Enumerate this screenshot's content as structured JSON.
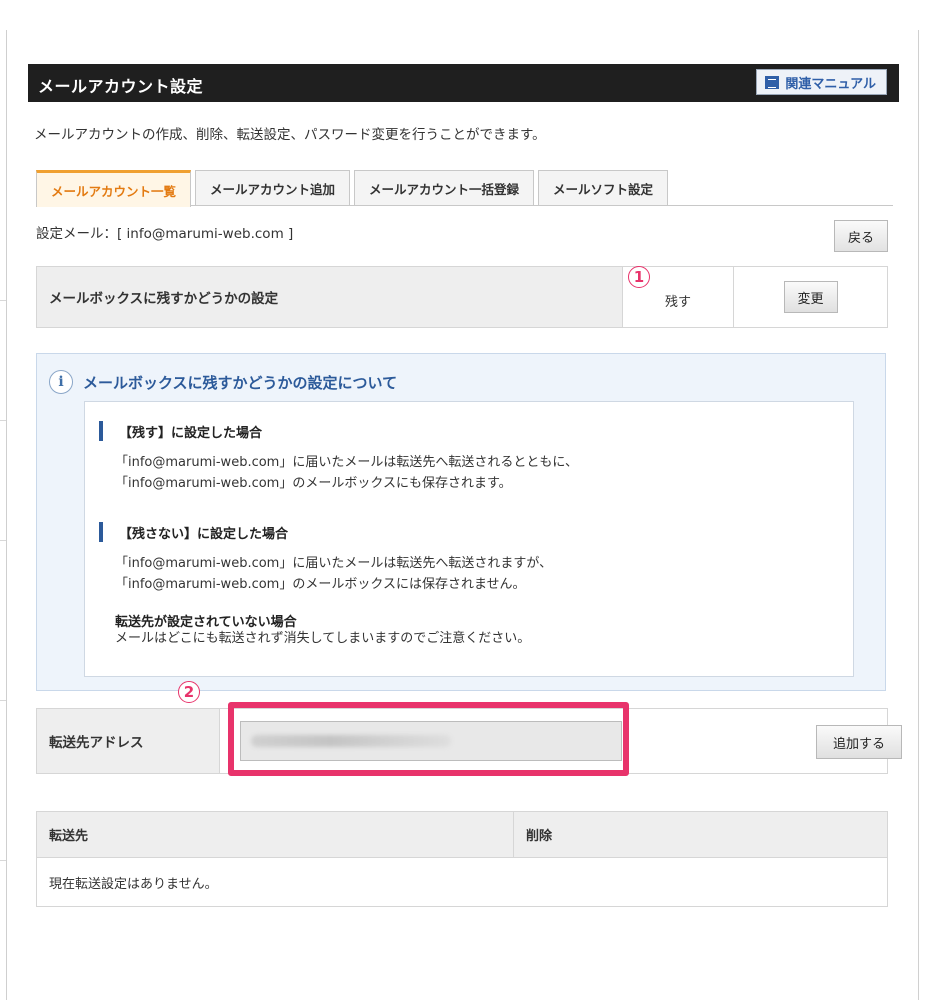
{
  "header": {
    "title": "メールアカウント設定",
    "manual_label": "関連マニュアル"
  },
  "description": "メールアカウントの作成、削除、転送設定、パスワード変更を行うことができます。",
  "tabs": [
    {
      "label": "メールアカウント一覧",
      "active": true
    },
    {
      "label": "メールアカウント追加",
      "active": false
    },
    {
      "label": "メールアカウント一括登録",
      "active": false
    },
    {
      "label": "メールソフト設定",
      "active": false
    }
  ],
  "setting_mail": "設定メール：[ info@marumi-web.com ]",
  "back_label": "戻る",
  "mailbox_setting": {
    "label": "メールボックスに残すかどうかの設定",
    "value": "残す",
    "change_label": "変更"
  },
  "markers": {
    "one": "1",
    "two": "2"
  },
  "info": {
    "title": "メールボックスに残すかどうかの設定について",
    "section1_head": "【残す】に設定した場合",
    "section1_line1": "「info@marumi-web.com」に届いたメールは転送先へ転送されるとともに、",
    "section1_line2": "「info@marumi-web.com」のメールボックスにも保存されます。",
    "section2_head": "【残さない】に設定した場合",
    "section2_line1": "「info@marumi-web.com」に届いたメールは転送先へ転送されますが、",
    "section2_line2": "「info@marumi-web.com」のメールボックスには保存されません。",
    "note_title": "転送先が設定されていない場合",
    "note_text": "メールはどこにも転送されず消失してしまいますのでご注意ください。"
  },
  "forward": {
    "label": "転送先アドレス",
    "input_value": "",
    "add_label": "追加する"
  },
  "table": {
    "headers": [
      "転送先",
      "削除"
    ],
    "empty_text": "現在転送設定はありません。"
  },
  "colors": {
    "accent_orange": "#e37b12",
    "highlight_pink": "#e8336b",
    "info_blue": "#2c5a9a"
  }
}
